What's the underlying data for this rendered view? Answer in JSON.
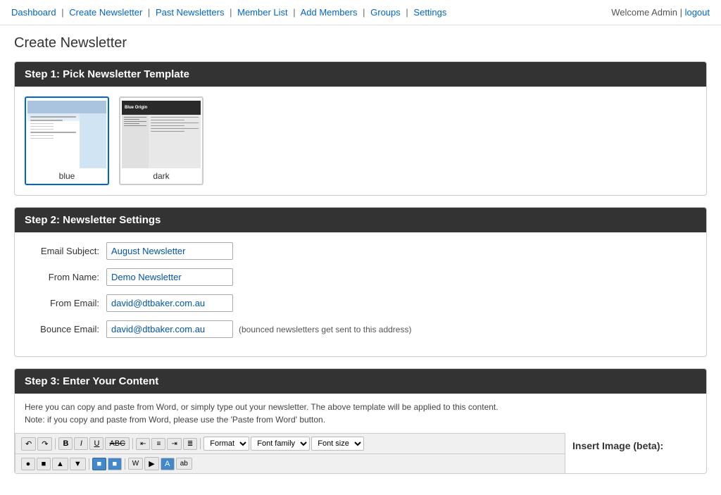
{
  "nav": {
    "links": [
      {
        "label": "Dashboard",
        "href": "#"
      },
      {
        "label": "Create Newsletter",
        "href": "#"
      },
      {
        "label": "Past Newsletters",
        "href": "#"
      },
      {
        "label": "Member List",
        "href": "#"
      },
      {
        "label": "Add Members",
        "href": "#"
      },
      {
        "label": "Groups",
        "href": "#"
      },
      {
        "label": "Settings",
        "href": "#"
      }
    ],
    "welcome": "Welcome Admin |",
    "logout": "logout"
  },
  "page": {
    "title": "Create Newsletter"
  },
  "step1": {
    "header": "Step 1: Pick Newsletter Template",
    "templates": [
      {
        "id": "blue",
        "label": "blue",
        "selected": true
      },
      {
        "id": "dark",
        "label": "dark",
        "selected": false
      }
    ]
  },
  "step2": {
    "header": "Step 2: Newsletter Settings",
    "fields": {
      "email_subject_label": "Email Subject:",
      "email_subject_value": "August Newsletter",
      "from_name_label": "From Name:",
      "from_name_value": "Demo Newsletter",
      "from_email_label": "From Email:",
      "from_email_value": "david@dtbaker.com.au",
      "bounce_email_label": "Bounce Email:",
      "bounce_email_value": "david@dtbaker.com.au",
      "bounce_note": "(bounced newsletters get sent to this address)"
    }
  },
  "step3": {
    "header": "Step 3: Enter Your Content",
    "note_line1": "Here you can copy and paste from Word, or simply type out your newsletter. The above template will be applied to this content.",
    "note_line2": "Note: if you copy and paste from Word, please use the 'Paste from Word' button.",
    "toolbar": {
      "format_label": "Format",
      "font_family_label": "Font family",
      "font_size_label": "Font size"
    },
    "insert_image": {
      "title": "Insert Image (beta):"
    }
  }
}
